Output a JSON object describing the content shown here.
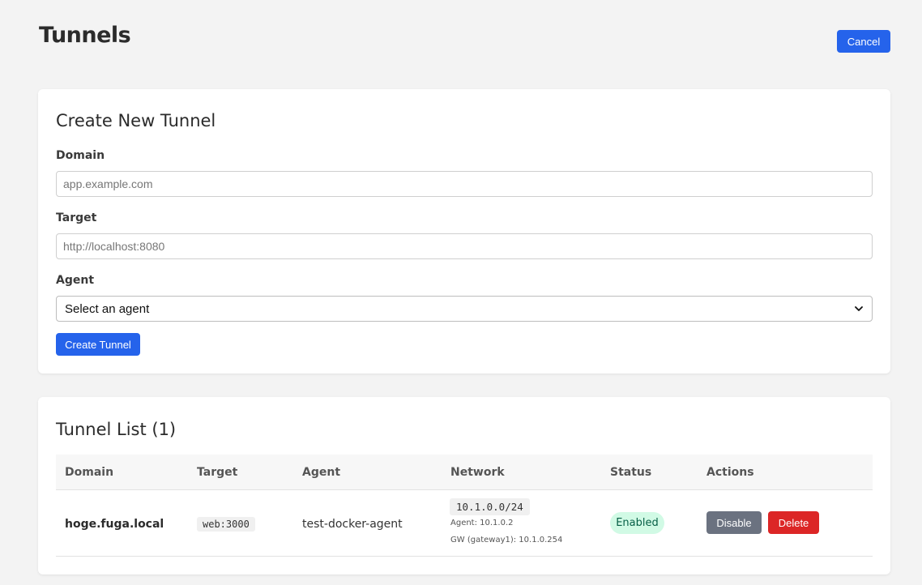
{
  "header": {
    "title": "Tunnels",
    "cancel_label": "Cancel"
  },
  "create_form": {
    "heading": "Create New Tunnel",
    "domain_label": "Domain",
    "domain_placeholder": "app.example.com",
    "target_label": "Target",
    "target_placeholder": "http://localhost:8080",
    "agent_label": "Agent",
    "agent_selected": "Select an agent",
    "submit_label": "Create Tunnel"
  },
  "tunnel_list": {
    "heading": "Tunnel List (1)",
    "columns": [
      "Domain",
      "Target",
      "Agent",
      "Network",
      "Status",
      "Actions"
    ],
    "rows": [
      {
        "domain": "hoge.fuga.local",
        "target": "web:3000",
        "agent": "test-docker-agent",
        "network_cidr": "10.1.0.0/24",
        "network_agent": "Agent: 10.1.0.2",
        "network_gw": "GW (gateway1): 10.1.0.254",
        "status": "Enabled",
        "disable_label": "Disable",
        "delete_label": "Delete"
      }
    ]
  },
  "colors": {
    "primary": "#2563eb",
    "danger": "#dc2626",
    "secondary": "#6b7280",
    "enabled_bg": "#d1fae5",
    "enabled_text": "#065f46"
  },
  "icons": {
    "select_chevron": "chevron-down-icon"
  }
}
